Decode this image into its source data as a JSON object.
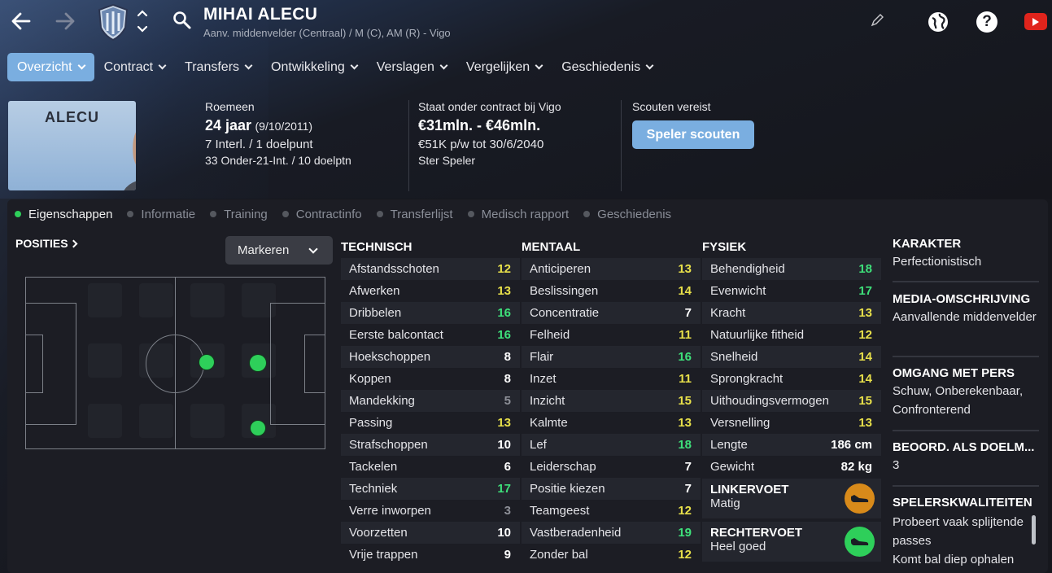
{
  "header": {
    "player_name": "MIHAI ALECU",
    "subtitle": "Aanv. middenvelder (Centraal) / M (C), AM (R) - Vigo",
    "icons": [
      "back-arrow-icon",
      "forward-arrow-icon",
      "club-crest-icon",
      "up-down-chevron-icon",
      "search-icon",
      "pencil-icon",
      "globe-icon",
      "help-icon",
      "youtube-icon"
    ]
  },
  "tabs": [
    {
      "label": "Overzicht"
    },
    {
      "label": "Contract"
    },
    {
      "label": "Transfers"
    },
    {
      "label": "Ontwikkeling"
    },
    {
      "label": "Verslagen"
    },
    {
      "label": "Vergelijken"
    },
    {
      "label": "Geschiedenis"
    }
  ],
  "profile": {
    "photo_name": "ALECU",
    "nationality": "Roemeen",
    "age": "24 jaar",
    "dob": "(9/10/2011)",
    "caps": "7 Interl. / 1 doelpunt",
    "u21": "33 Onder-21-Int. / 10 doelptn",
    "contract_label": "Staat onder contract bij Vigo",
    "value": "€31mln. - €46mln.",
    "wage": "€51K p/w tot 30/6/2040",
    "status": "Ster Speler",
    "scout_label": "Scouten vereist",
    "scout_button": "Speler scouten"
  },
  "subtabs": [
    {
      "label": "Eigenschappen"
    },
    {
      "label": "Informatie"
    },
    {
      "label": "Training"
    },
    {
      "label": "Contractinfo"
    },
    {
      "label": "Transferlijst"
    },
    {
      "label": "Medisch rapport"
    },
    {
      "label": "Geschiedenis"
    }
  ],
  "positions": {
    "label": "POSITIES",
    "mark_button": "Markeren"
  },
  "technical": {
    "title": "TECHNISCH",
    "attributes": [
      {
        "name": "Afstandsschoten",
        "value": "12"
      },
      {
        "name": "Afwerken",
        "value": "13"
      },
      {
        "name": "Dribbelen",
        "value": "16"
      },
      {
        "name": "Eerste balcontact",
        "value": "16"
      },
      {
        "name": "Hoekschoppen",
        "value": "8"
      },
      {
        "name": "Koppen",
        "value": "8"
      },
      {
        "name": "Mandekking",
        "value": "5"
      },
      {
        "name": "Passing",
        "value": "13"
      },
      {
        "name": "Strafschoppen",
        "value": "10"
      },
      {
        "name": "Tackelen",
        "value": "6"
      },
      {
        "name": "Techniek",
        "value": "17"
      },
      {
        "name": "Verre inworpen",
        "value": "3"
      },
      {
        "name": "Voorzetten",
        "value": "10"
      },
      {
        "name": "Vrije trappen",
        "value": "9"
      }
    ]
  },
  "mental": {
    "title": "MENTAAL",
    "attributes": [
      {
        "name": "Anticiperen",
        "value": "13"
      },
      {
        "name": "Beslissingen",
        "value": "14"
      },
      {
        "name": "Concentratie",
        "value": "7"
      },
      {
        "name": "Felheid",
        "value": "11"
      },
      {
        "name": "Flair",
        "value": "16"
      },
      {
        "name": "Inzet",
        "value": "11"
      },
      {
        "name": "Inzicht",
        "value": "15"
      },
      {
        "name": "Kalmte",
        "value": "13"
      },
      {
        "name": "Lef",
        "value": "18"
      },
      {
        "name": "Leiderschap",
        "value": "7"
      },
      {
        "name": "Positie kiezen",
        "value": "7"
      },
      {
        "name": "Teamgeest",
        "value": "12"
      },
      {
        "name": "Vastberadenheid",
        "value": "19"
      },
      {
        "name": "Zonder bal",
        "value": "12"
      }
    ]
  },
  "physical": {
    "title": "FYSIEK",
    "attributes": [
      {
        "name": "Behendigheid",
        "value": "18"
      },
      {
        "name": "Evenwicht",
        "value": "17"
      },
      {
        "name": "Kracht",
        "value": "13"
      },
      {
        "name": "Natuurlijke fitheid",
        "value": "12"
      },
      {
        "name": "Snelheid",
        "value": "14"
      },
      {
        "name": "Sprongkracht",
        "value": "14"
      },
      {
        "name": "Uithoudingsvermogen",
        "value": "15"
      },
      {
        "name": "Versnelling",
        "value": "13"
      },
      {
        "name": "Lengte",
        "value": "186 cm"
      },
      {
        "name": "Gewicht",
        "value": "82 kg"
      }
    ],
    "left_foot_label": "LINKERVOET",
    "left_foot_value": "Matig",
    "right_foot_label": "RECHTERVOET",
    "right_foot_value": "Heel goed"
  },
  "side": {
    "character_label": "KARAKTER",
    "character_value": "Perfectionistisch",
    "media_label": "MEDIA-OMSCHRIJVING",
    "media_value": "Aanvallende middenvelder",
    "press_label": "OMGANG MET PERS",
    "press_value": "Schuw, Onberekenbaar, Confronterend",
    "gk_label": "BEOORD. ALS DOELM...",
    "gk_value": "3",
    "traits_label": "SPELERSKWALITEITEN",
    "traits_value": "Probeert vaak splijtende passes",
    "traits_value2": "Komt bal diep ophalen"
  },
  "colors": {
    "accent": "#7aaee0",
    "attr_white": "#ffffff",
    "attr_yellow": "#e8e04a",
    "attr_green": "#3ee07a",
    "attr_grey": "#8e9098",
    "foot_weak": "#d88a1a",
    "foot_strong": "#2ecf5a"
  }
}
